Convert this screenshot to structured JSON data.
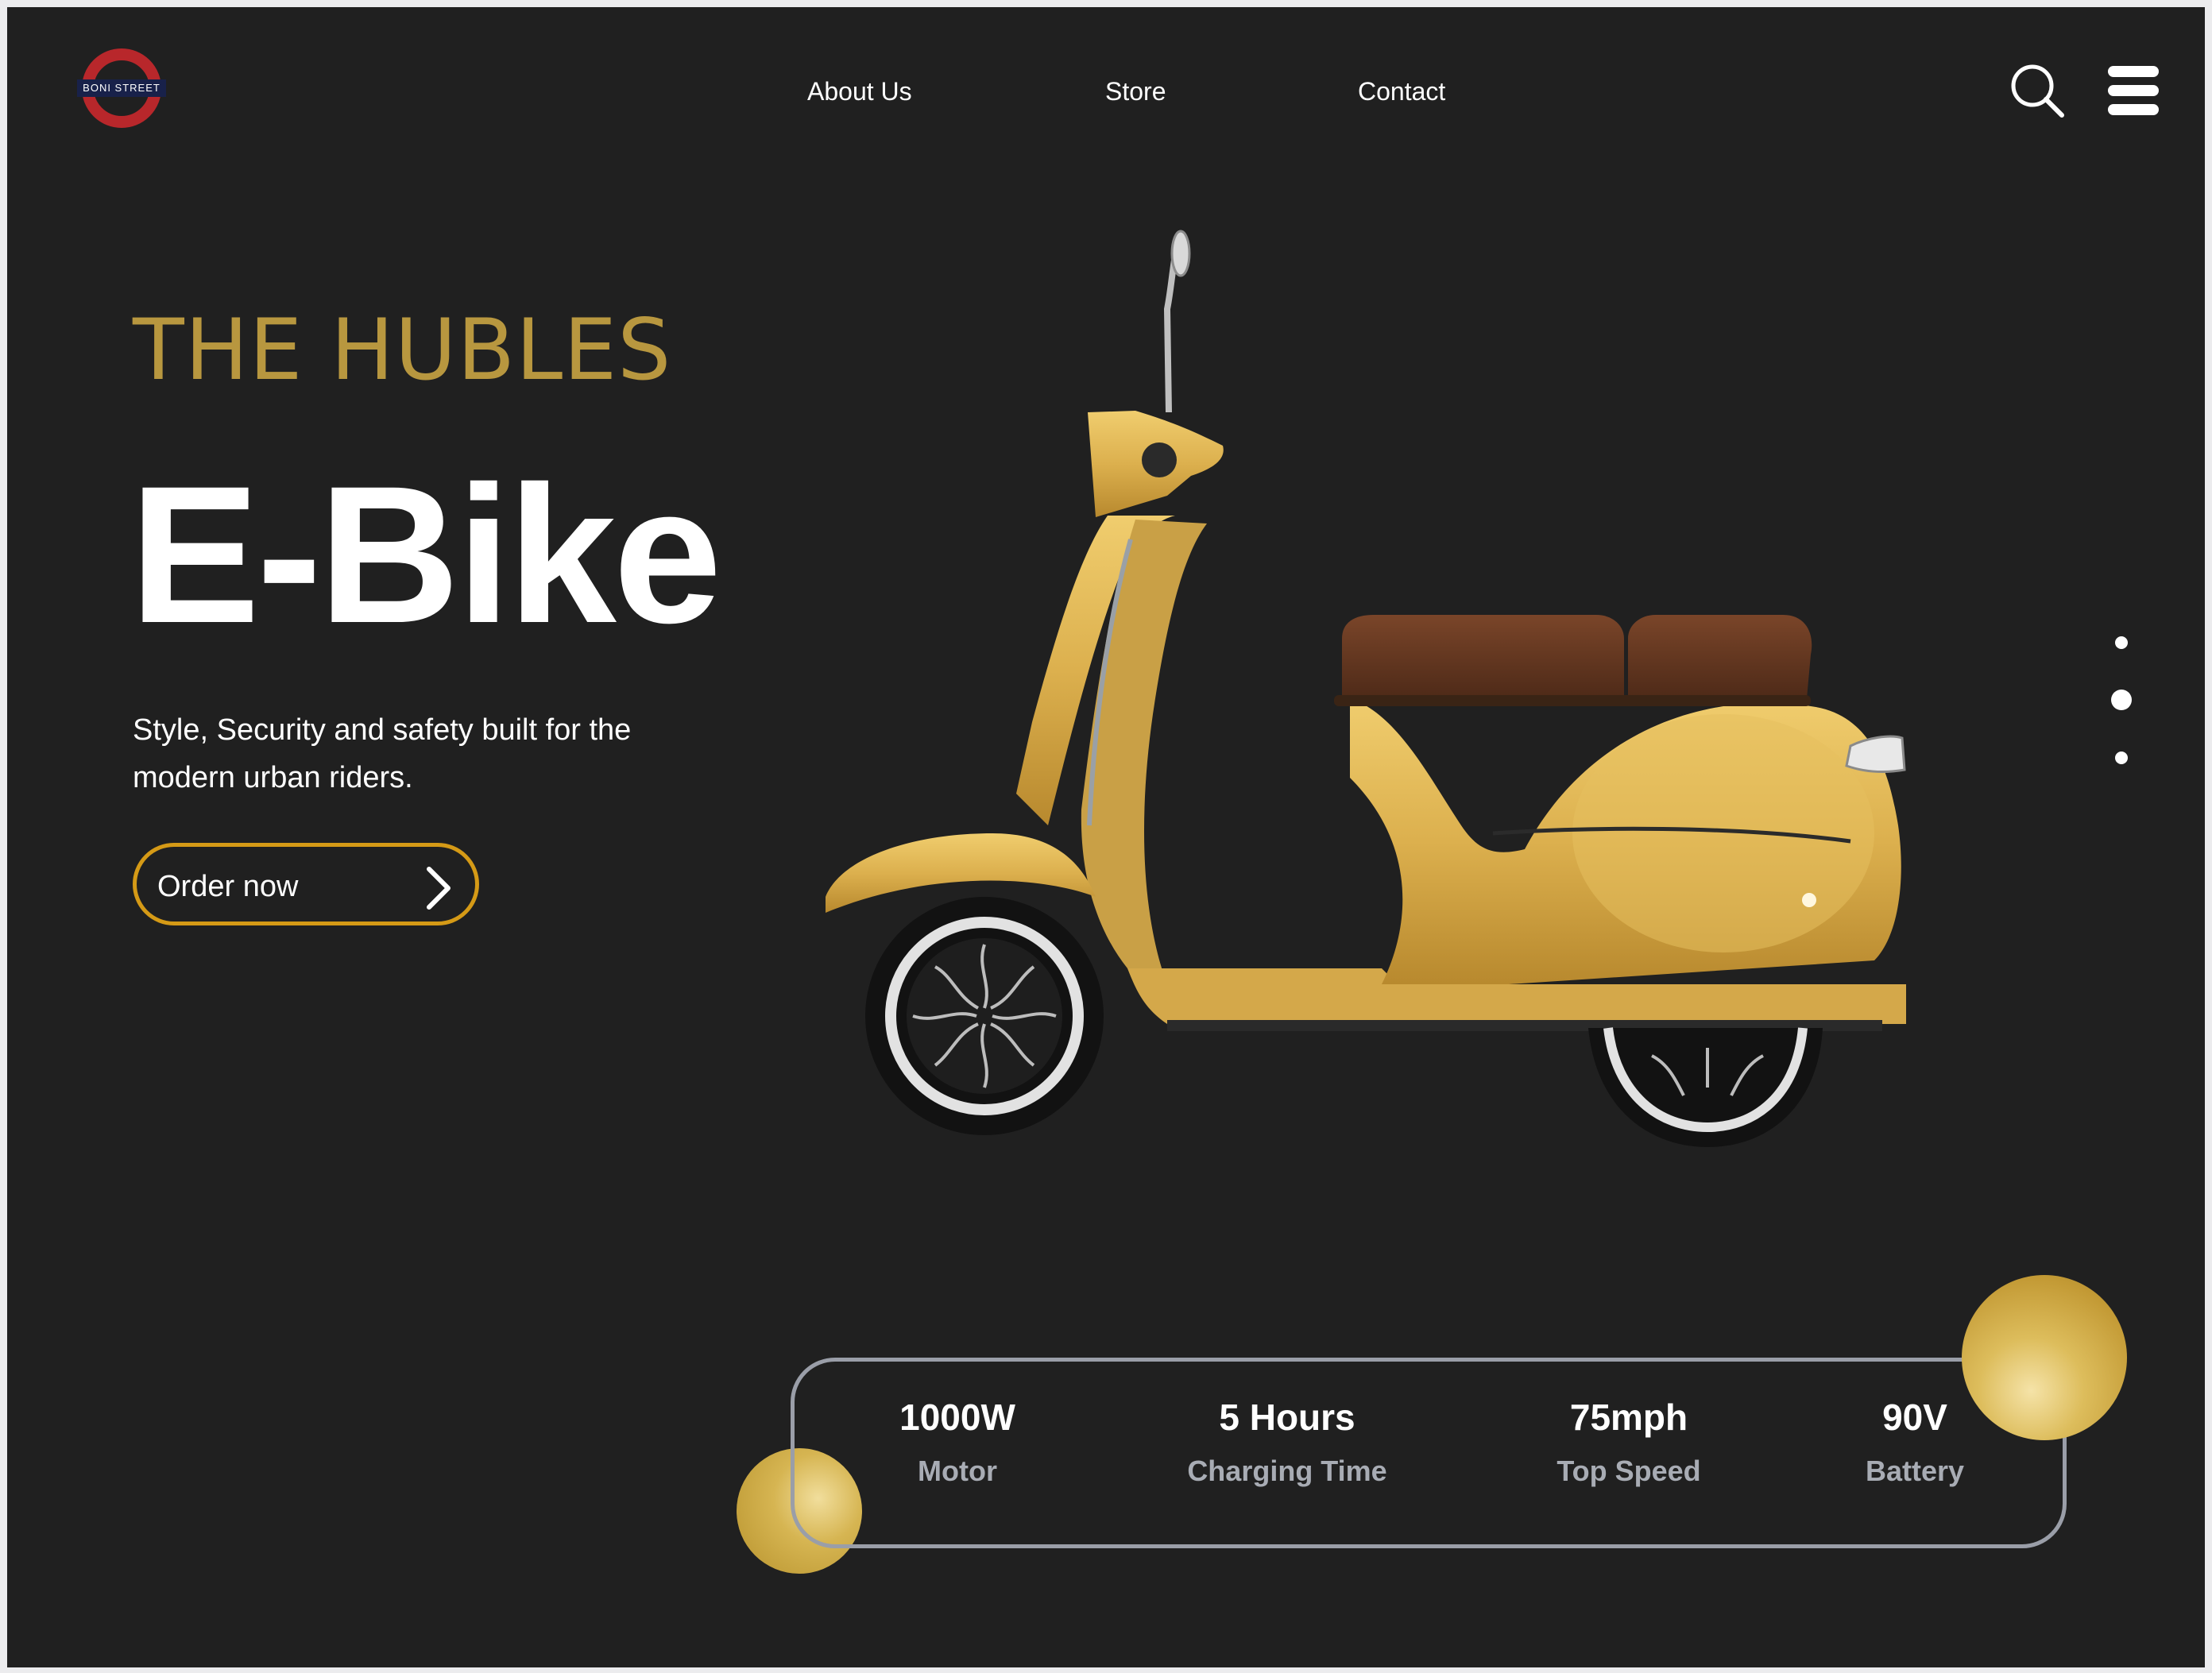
{
  "brand": {
    "logo_text": "BONI  STREET",
    "colors": {
      "ring": "#b8272b",
      "bar": "#18214a"
    }
  },
  "nav": {
    "items": [
      {
        "label": "About Us"
      },
      {
        "label": "Store"
      },
      {
        "label": "Contact"
      }
    ],
    "search_icon": "search-icon",
    "menu_icon": "hamburger-menu-icon"
  },
  "hero": {
    "eyebrow": "THE HUBLES",
    "title": "E-Bike",
    "tagline": "Style, Security and safety built for the modern urban riders.",
    "cta_label": "Order now",
    "cta_icon": "chevron-right-icon",
    "image": "yellow-scooter-image"
  },
  "carousel": {
    "count": 3,
    "active_index": 1
  },
  "specs": [
    {
      "value": "1000W",
      "label": "Motor"
    },
    {
      "value": "5 Hours",
      "label": "Charging Time"
    },
    {
      "value": "75mph",
      "label": "Top Speed"
    },
    {
      "value": "90V",
      "label": "Battery"
    }
  ],
  "colors": {
    "background": "#202020",
    "accent": "#d59a16",
    "eyebrow": "#b8973f",
    "spec_label": "#a8acb4",
    "spec_border": "#9a9ea8"
  }
}
